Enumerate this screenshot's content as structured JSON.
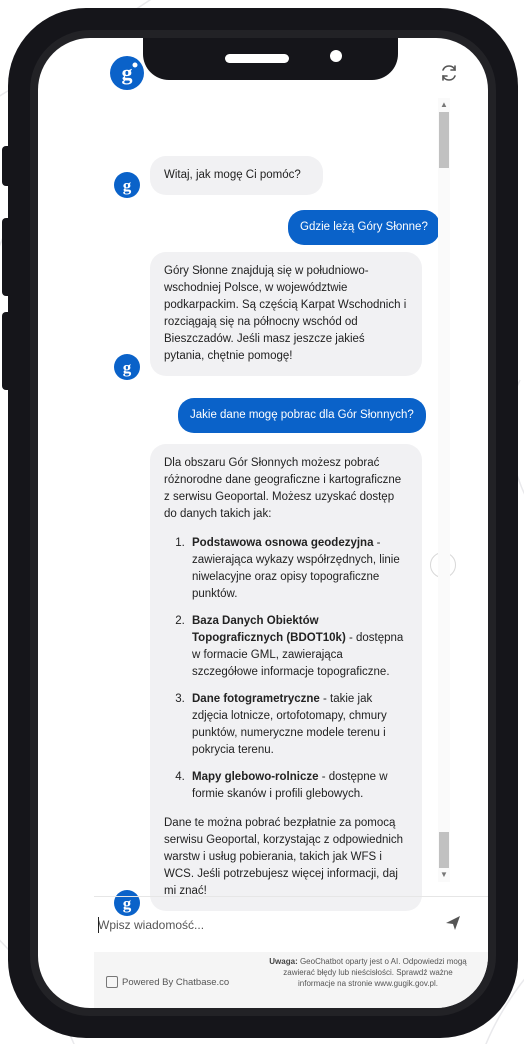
{
  "header": {
    "logo_icon": "chatbot-logo-icon",
    "refresh_icon": "refresh-icon"
  },
  "messages": [
    {
      "role": "bot",
      "text": "Witaj, jak mogę Ci pomóc?"
    },
    {
      "role": "user",
      "text": "Gdzie leżą Góry Słonne?"
    },
    {
      "role": "bot",
      "text": "Góry Słonne znajdują się w południowo-wschodniej Polsce, w województwie podkarpackim. Są częścią Karpat Wschodnich i rozciągają się na północny wschód od Bieszczadów. Jeśli masz jeszcze jakieś pytania, chętnie pomogę!"
    },
    {
      "role": "user",
      "text": "Jakie dane mogę pobrac dla Gór Słonnych?"
    },
    {
      "role": "bot",
      "intro": "Dla obszaru Gór Słonnych możesz pobrać różnorodne dane geograficzne i kartograficzne z serwisu Geoportal. Możesz uzyskać dostęp do danych takich jak:",
      "items": [
        {
          "title": "Podstawowa osnowa geodezyjna",
          "desc": " - zawierająca wykazy współrzędnych, linie niwelacyjne oraz opisy topograficzne punktów."
        },
        {
          "title": "Baza Danych Obiektów Topograficznych (BDOT10k)",
          "desc": " - dostępna w formacie GML, zawierająca szczegółowe informacje topograficzne."
        },
        {
          "title": "Dane fotogrametryczne",
          "desc": " - takie jak zdjęcia lotnicze, ortofotomapy, chmury punktów, numeryczne modele terenu i pokrycia terenu."
        },
        {
          "title": "Mapy glebowo-rolnicze",
          "desc": " - dostępne w formie skanów i profili glebowych."
        }
      ],
      "outro": "Dane te można pobrać bezpłatnie za pomocą serwisu Geoportal, korzystając z odpowiednich warstw i usług pobierania, takich jak WFS i WCS. Jeśli potrzebujesz więcej informacji, daj mi znać!"
    }
  ],
  "input": {
    "placeholder": "Wpisz wiadomość...",
    "value": "",
    "send_icon": "send-icon"
  },
  "footer": {
    "powered_by": "Powered By Chatbase.co",
    "disclaimer_label": "Uwaga:",
    "disclaimer_text": " GeoChatbot oparty jest o AI. Odpowiedzi mogą zawierać błędy lub nieścisłości. Sprawdź ważne informacje na stronie www.gugik.gov.pl."
  },
  "colors": {
    "accent": "#0a62c9",
    "bot_bubble": "#f1f1f3",
    "phone_frame": "#15151a"
  }
}
